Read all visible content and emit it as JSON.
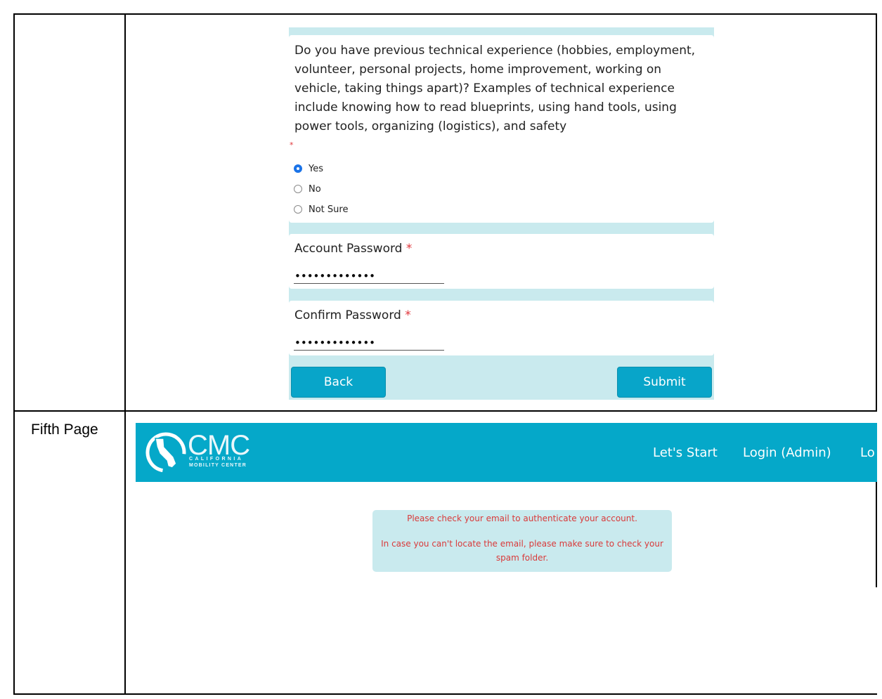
{
  "form": {
    "question": "Do you have previous technical experience (hobbies, employment, volunteer, personal projects, home improvement, working on vehicle, taking things apart)? Examples of technical experience include knowing how to read blueprints, using hand tools, using power tools, organizing (logistics), and safety",
    "required_mark": "*",
    "options": [
      {
        "label": "Yes",
        "checked": true
      },
      {
        "label": "No",
        "checked": false
      },
      {
        "label": "Not Sure",
        "checked": false
      }
    ],
    "account_password_label": "Account Password",
    "account_password_value": "•••••••••••••",
    "confirm_password_label": "Confirm Password",
    "confirm_password_value": "•••••••••••••",
    "back_label": "Back",
    "submit_label": "Submit"
  },
  "row_label": "Fifth Page",
  "fifth_page": {
    "logo": {
      "title": "CMC",
      "subtitle_1": "CALIFORNIA",
      "subtitle_2": "MOBILITY CENTER"
    },
    "nav": [
      "Let's Start",
      "Login (Admin)",
      "Lo"
    ],
    "notice": {
      "line1": "Please check your email to authenticate your account.",
      "line2": "In case you can't locate the email, please make sure to check your spam folder."
    }
  },
  "colors": {
    "accent": "#05a8c9",
    "panel": "#c9eaee",
    "required": "#e0363b",
    "radio_checked": "#1a73e8",
    "notice_text": "#d93a3a"
  }
}
